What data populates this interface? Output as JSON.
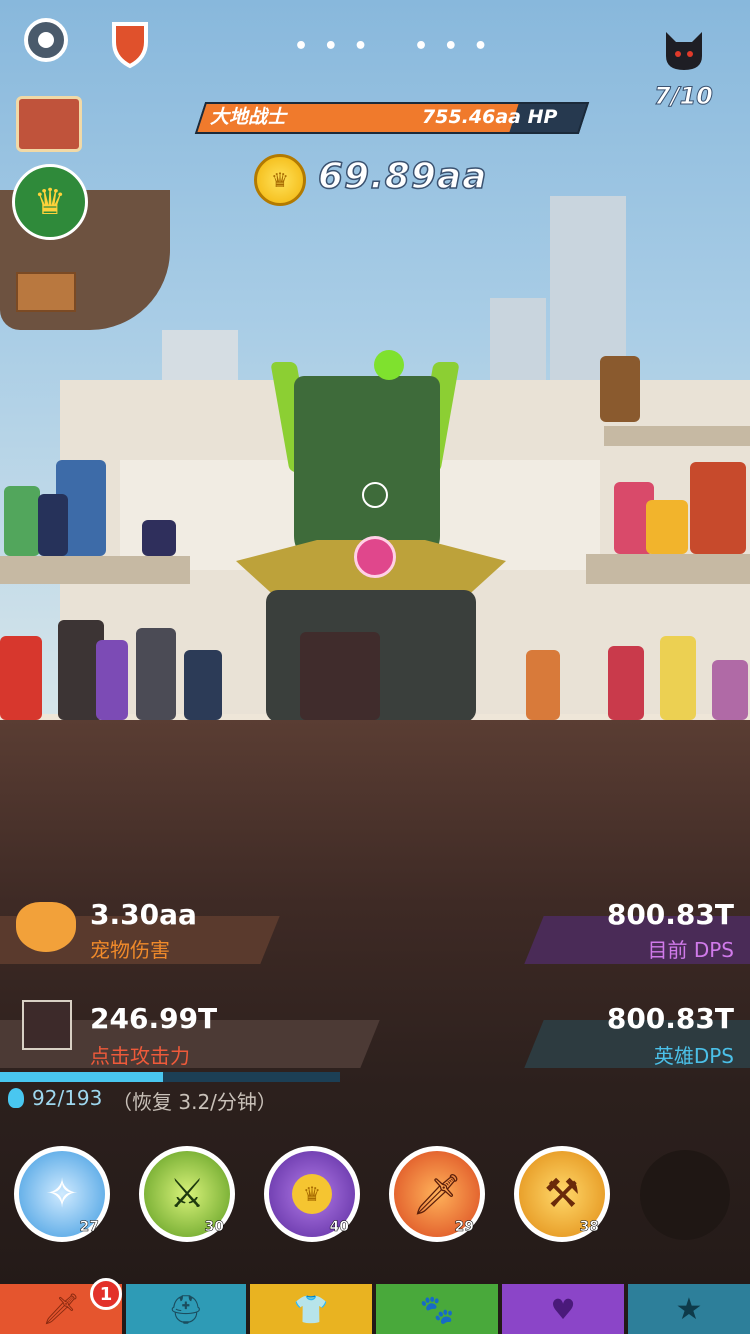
{
  "boss": {
    "name": "大地战士",
    "hp": "755.46aa HP",
    "hp_fraction": 0.82
  },
  "gold": {
    "amount": "69.89aa"
  },
  "stage": {
    "progress": "7/10"
  },
  "top_bar": {
    "dots_left": "• • •",
    "dots_right": "• • •"
  },
  "stats": {
    "pet_damage": {
      "value": "3.30aa",
      "label": "宠物伤害"
    },
    "current_dps": {
      "value": "800.83T",
      "label": "目前 DPS"
    },
    "tap_damage": {
      "value": "246.99T",
      "label": "点击攻击力"
    },
    "hero_dps": {
      "value": "800.83T",
      "label": "英雄DPS"
    }
  },
  "mana": {
    "current": "92/193",
    "regen": "（恢复 3.2/分钟）",
    "fraction": 0.48
  },
  "skills": [
    {
      "name": "heavenly-strike",
      "level": "27"
    },
    {
      "name": "deadly-strike",
      "level": "30"
    },
    {
      "name": "hand-of-midas",
      "level": "40"
    },
    {
      "name": "fire-sword",
      "level": "29"
    },
    {
      "name": "war-cry",
      "level": "38"
    }
  ],
  "tabs": [
    {
      "name": "sword",
      "badge": "1",
      "color": "#e5552e"
    },
    {
      "name": "heroes",
      "color": "#2e9bb6"
    },
    {
      "name": "equipment",
      "color": "#e9b321"
    },
    {
      "name": "pets",
      "color": "#49a93b"
    },
    {
      "name": "clan",
      "color": "#8b45c8"
    },
    {
      "name": "artifacts",
      "color": "#2d7f9a"
    }
  ]
}
